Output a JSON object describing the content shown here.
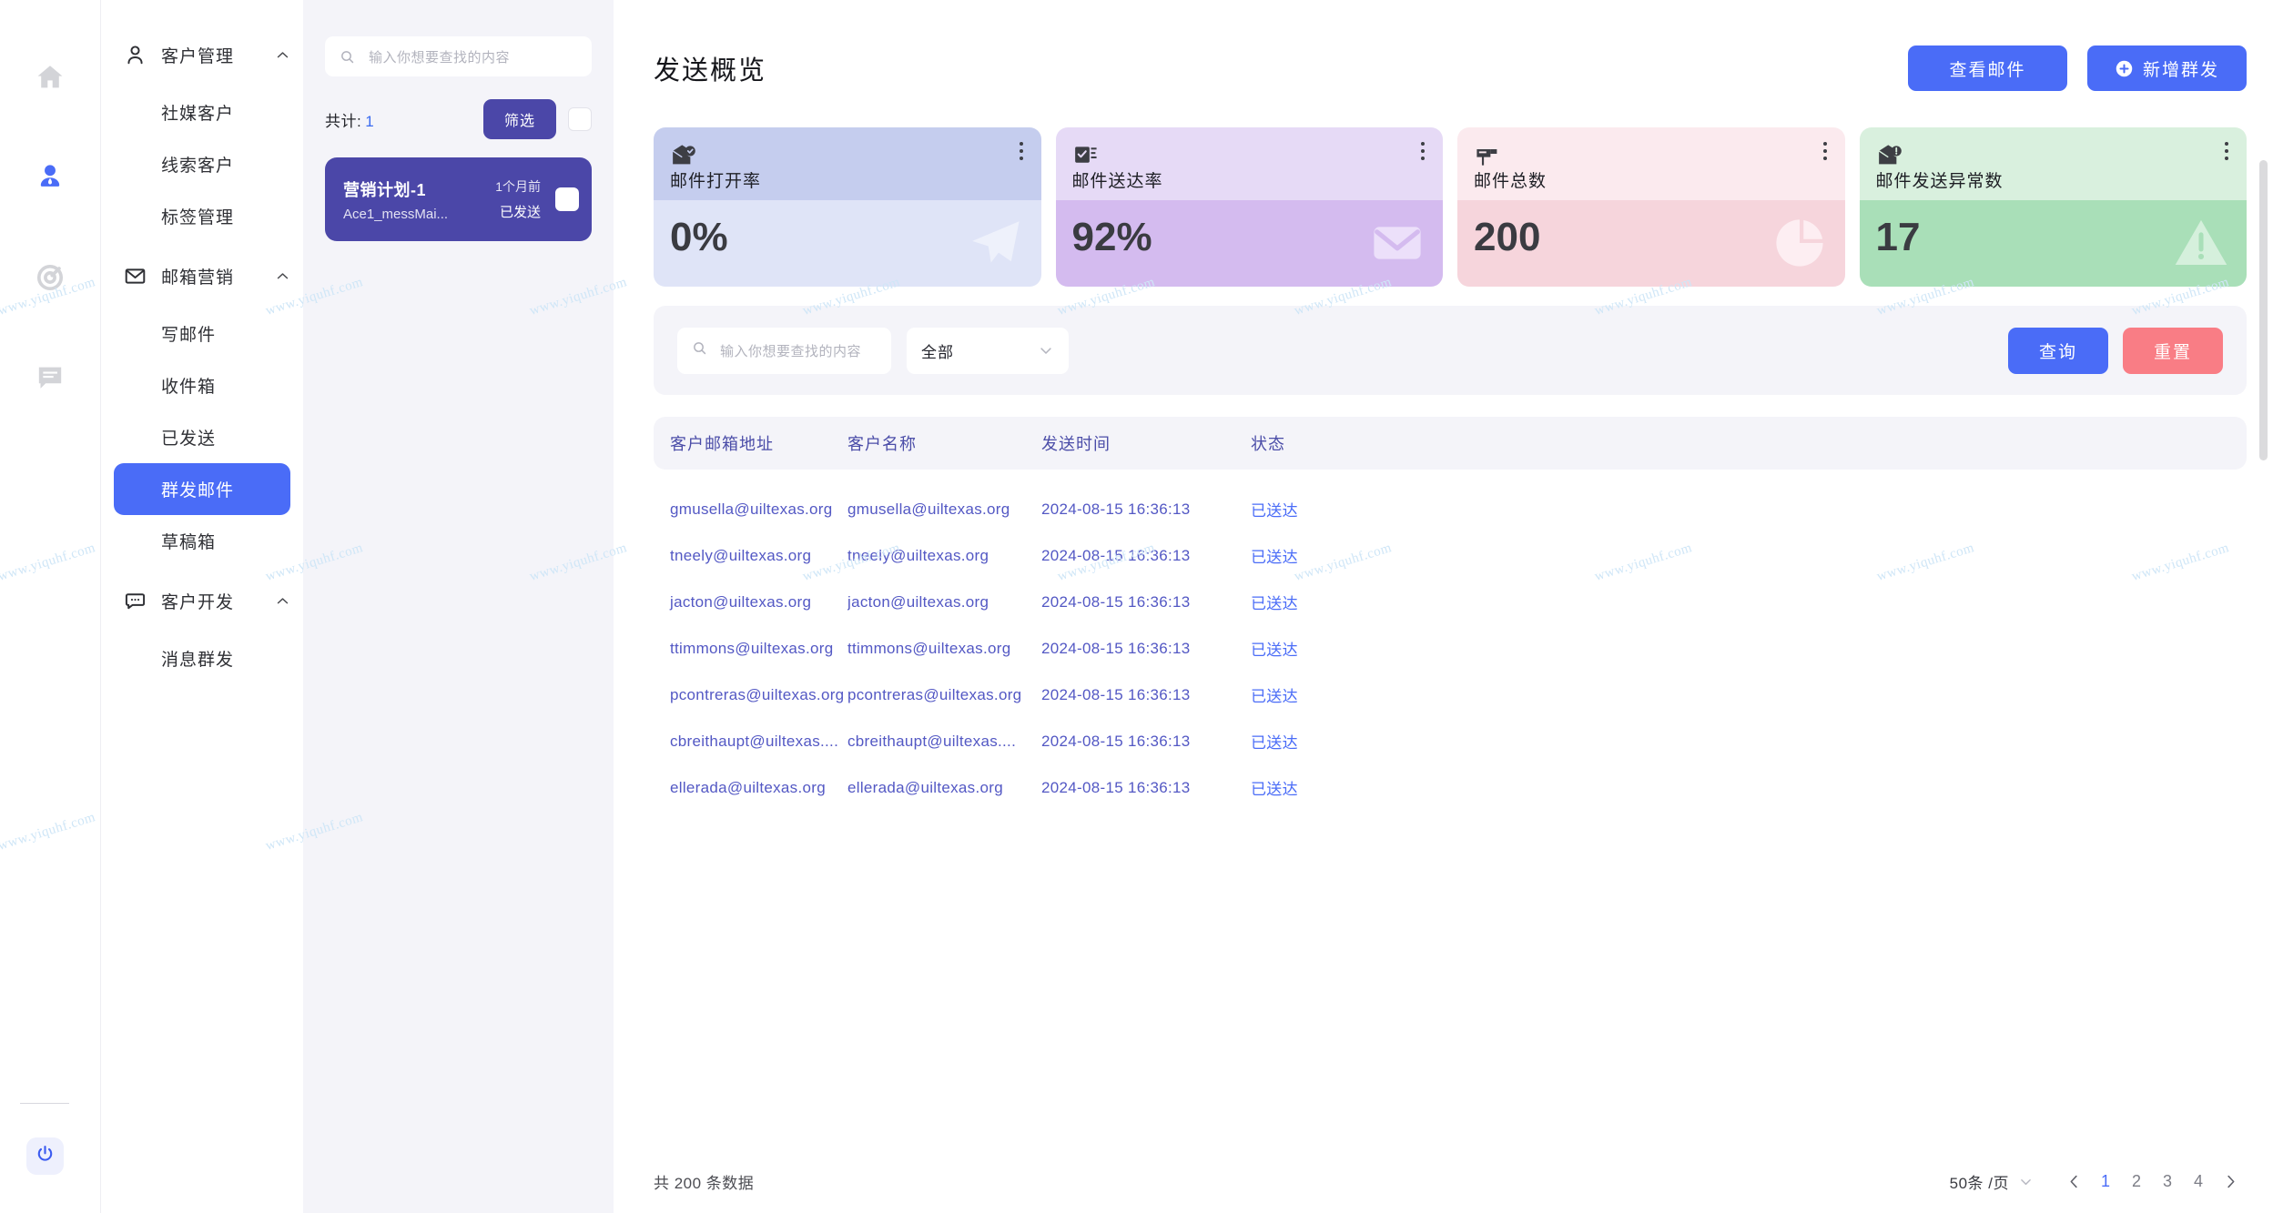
{
  "rail": {
    "items": [
      {
        "icon": "home-icon",
        "active": false
      },
      {
        "icon": "user-icon",
        "active": true
      },
      {
        "icon": "target-icon",
        "active": false
      },
      {
        "icon": "chat-icon",
        "active": false
      }
    ],
    "power": "power-icon"
  },
  "nav": {
    "groups": [
      {
        "label": "客户管理",
        "icon": "person-outline-icon",
        "chevron": "chevron-up-icon",
        "items": [
          {
            "label": "社媒客户",
            "active": false
          },
          {
            "label": "线索客户",
            "active": false
          },
          {
            "label": "标签管理",
            "active": false
          }
        ]
      },
      {
        "label": "邮箱营销",
        "icon": "mail-icon",
        "chevron": "chevron-up-icon",
        "items": [
          {
            "label": "写邮件",
            "active": false
          },
          {
            "label": "收件箱",
            "active": false
          },
          {
            "label": "已发送",
            "active": false
          },
          {
            "label": "群发邮件",
            "active": true
          },
          {
            "label": "草稿箱",
            "active": false
          }
        ]
      },
      {
        "label": "客户开发",
        "icon": "chat-box-icon",
        "chevron": "chevron-up-icon",
        "items": [
          {
            "label": "消息群发",
            "active": false
          }
        ]
      }
    ]
  },
  "list_panel": {
    "search_placeholder": "输入你想要查找的内容",
    "total_label": "共计:",
    "total_count": "1",
    "filter_button": "筛选",
    "campaigns": [
      {
        "title": "营销计划-1",
        "subtitle": "Ace1_messMai...",
        "time": "1个月前",
        "status": "已发送",
        "selected": true
      }
    ]
  },
  "main": {
    "title": "发送概览",
    "view_mail_button": "查看邮件",
    "new_campaign_button": "新增群发",
    "cards": [
      {
        "label": "邮件打开率",
        "value": "0%",
        "icon": "mail-open-check-icon",
        "deco": "paper-plane-icon",
        "top_bg": "#c5cdee",
        "bot_bg": "#dfe4f7",
        "deco_color": "#eef1fb"
      },
      {
        "label": "邮件送达率",
        "value": "92%",
        "icon": "mail-checklist-icon",
        "deco": "envelope-icon",
        "top_bg": "#e6daf6",
        "bot_bg": "#d4bbef",
        "deco_color": "#ece0fa"
      },
      {
        "label": "邮件总数",
        "value": "200",
        "icon": "mailbox-icon",
        "deco": "pie-icon",
        "top_bg": "#fbeaee",
        "bot_bg": "#f6d5dc",
        "deco_color": "#fdeef2"
      },
      {
        "label": "邮件发送异常数",
        "value": "17",
        "icon": "mail-alert-icon",
        "deco": "warning-icon",
        "top_bg": "#d9f0de",
        "bot_bg": "#a9dfb8",
        "deco_color": "#d5f0dc"
      }
    ],
    "filter": {
      "search_placeholder": "输入你想要查找的内容",
      "select_value": "全部",
      "query_button": "查询",
      "reset_button": "重置"
    },
    "table": {
      "columns": [
        "客户邮箱地址",
        "客户名称",
        "发送时间",
        "状态"
      ],
      "rows": [
        {
          "email": "gmusella@uiltexas.org",
          "name": "gmusella@uiltexas.org",
          "time": "2024-08-15 16:36:13",
          "status": "已送达"
        },
        {
          "email": "tneely@uiltexas.org",
          "name": "tneely@uiltexas.org",
          "time": "2024-08-15 16:36:13",
          "status": "已送达"
        },
        {
          "email": "jacton@uiltexas.org",
          "name": "jacton@uiltexas.org",
          "time": "2024-08-15 16:36:13",
          "status": "已送达"
        },
        {
          "email": "ttimmons@uiltexas.org",
          "name": "ttimmons@uiltexas.org",
          "time": "2024-08-15 16:36:13",
          "status": "已送达"
        },
        {
          "email": "pcontreras@uiltexas.org",
          "name": "pcontreras@uiltexas.org",
          "time": "2024-08-15 16:36:13",
          "status": "已送达"
        },
        {
          "email": "cbreithaupt@uiltexas....",
          "name": "cbreithaupt@uiltexas....",
          "time": "2024-08-15 16:36:13",
          "status": "已送达"
        },
        {
          "email": "ellerada@uiltexas.org",
          "name": "ellerada@uiltexas.org",
          "time": "2024-08-15 16:36:13",
          "status": "已送达"
        }
      ]
    },
    "pagination": {
      "total_text": "共 200 条数据",
      "page_size": "50条 /页",
      "prev": "‹",
      "next": "›",
      "pages": [
        "1",
        "2",
        "3",
        "4"
      ],
      "current_page": "1"
    }
  },
  "watermark": "www.yiquhf.com"
}
